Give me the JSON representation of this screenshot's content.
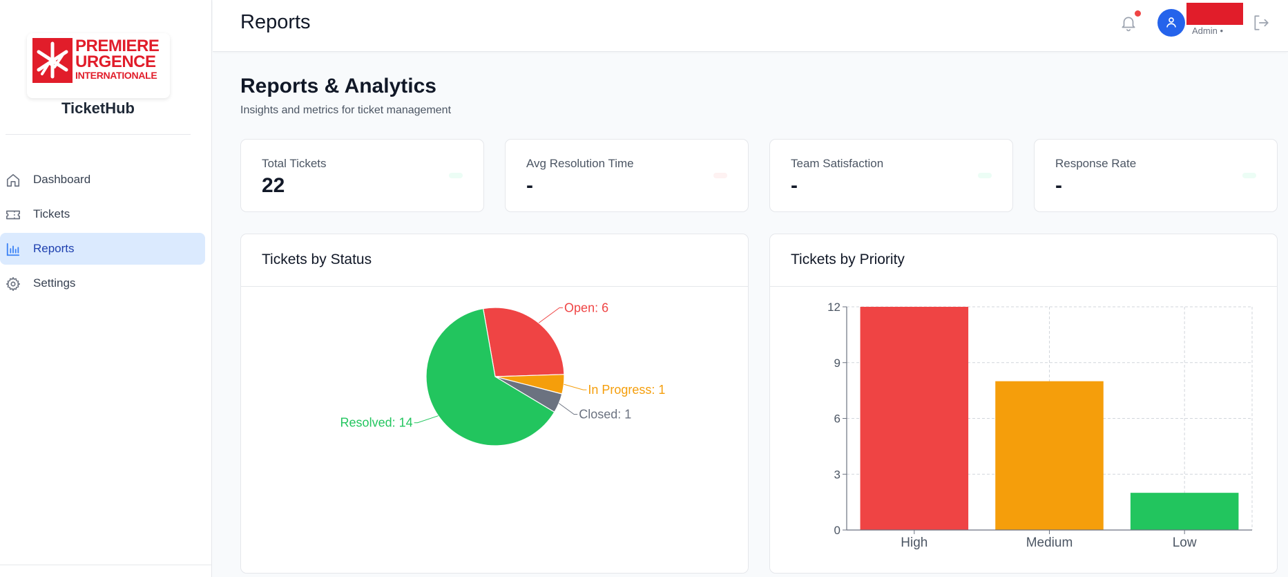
{
  "app": {
    "name": "TicketHub"
  },
  "logo": {
    "line1": "PREMIERE",
    "line2": "URGENCE",
    "line3": "INTERNATIONALE"
  },
  "sidebar": {
    "items": [
      {
        "label": "Dashboard",
        "icon": "home-icon",
        "active": false
      },
      {
        "label": "Tickets",
        "icon": "ticket-icon",
        "active": false
      },
      {
        "label": "Reports",
        "icon": "bar-chart-icon",
        "active": true
      },
      {
        "label": "Settings",
        "icon": "gear-icon",
        "active": false
      }
    ]
  },
  "header": {
    "title": "Reports",
    "user_role": "Admin •",
    "notification_dot_color": "#ef4444"
  },
  "page": {
    "title": "Reports & Analytics",
    "subtitle": "Insights and metrics for ticket management"
  },
  "stats": [
    {
      "label": "Total Tickets",
      "value": "22",
      "pill_color": "#ecfdf5"
    },
    {
      "label": "Avg Resolution Time",
      "value": "-",
      "pill_color": "#fef2f2"
    },
    {
      "label": "Team Satisfaction",
      "value": "-",
      "pill_color": "#ecfdf5"
    },
    {
      "label": "Response Rate",
      "value": "-",
      "pill_color": "#ecfdf5"
    }
  ],
  "status_card": {
    "title": "Tickets by Status"
  },
  "priority_card": {
    "title": "Tickets by Priority"
  },
  "chart_data": [
    {
      "type": "pie",
      "slices": [
        {
          "label": "Open",
          "value": 6,
          "color": "#ef4444"
        },
        {
          "label": "In Progress",
          "value": 1,
          "color": "#f59e0b"
        },
        {
          "label": "Closed",
          "value": 1,
          "color": "#6b7280"
        },
        {
          "label": "Resolved",
          "value": 14,
          "color": "#22c55e"
        }
      ]
    },
    {
      "type": "bar",
      "categories": [
        "High",
        "Medium",
        "Low"
      ],
      "values": [
        12,
        8,
        2
      ],
      "colors": [
        "#ef4444",
        "#f59e0b",
        "#22c55e"
      ],
      "ylim": [
        0,
        12
      ],
      "yticks": [
        0,
        3,
        6,
        9,
        12
      ],
      "grid": true
    }
  ]
}
